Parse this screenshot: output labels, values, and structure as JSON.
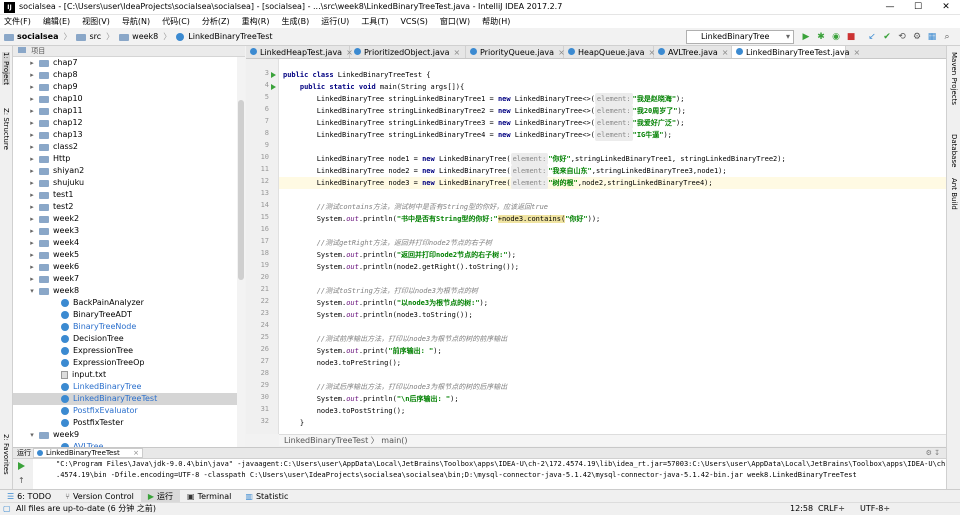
{
  "window": {
    "title": "socialsea - [C:\\Users\\user\\IdeaProjects\\socialsea\\socialsea] - [socialsea] - ...\\src\\week8\\LinkedBinaryTreeTest.java - IntelliJ IDEA 2017.2.7",
    "logo": "IJ",
    "minimize": "—",
    "maximize": "☐",
    "close": "✕"
  },
  "menu": [
    "文件(F)",
    "编辑(E)",
    "视图(V)",
    "导航(N)",
    "代码(C)",
    "分析(Z)",
    "重构(R)",
    "生成(B)",
    "运行(U)",
    "工具(T)",
    "VCS(S)",
    "窗口(W)",
    "帮助(H)"
  ],
  "breadcrumb": [
    "socialsea",
    "src",
    "week8",
    "LinkedBinaryTreeTest"
  ],
  "run_config": "LinkedBinaryTree",
  "left_strip": {
    "project": "1: Project",
    "structure": "Z: Structure",
    "favorites": "2: Favorites"
  },
  "right_strip": {
    "maven": "Maven Projects",
    "database": "Database",
    "ant": "Ant Build"
  },
  "project_panel": {
    "header": "项目",
    "items": [
      {
        "label": "chap7",
        "kind": "folder",
        "depth": 1,
        "expanded": false
      },
      {
        "label": "chap8",
        "kind": "folder",
        "depth": 1,
        "expanded": false
      },
      {
        "label": "chap9",
        "kind": "folder",
        "depth": 1,
        "expanded": false
      },
      {
        "label": "chap10",
        "kind": "folder",
        "depth": 1,
        "expanded": false
      },
      {
        "label": "chap11",
        "kind": "folder",
        "depth": 1,
        "expanded": false
      },
      {
        "label": "chap12",
        "kind": "folder",
        "depth": 1,
        "expanded": false
      },
      {
        "label": "chap13",
        "kind": "folder",
        "depth": 1,
        "expanded": false
      },
      {
        "label": "class2",
        "kind": "folder",
        "depth": 1,
        "expanded": false
      },
      {
        "label": "Http",
        "kind": "folder",
        "depth": 1,
        "expanded": false
      },
      {
        "label": "shiyan2",
        "kind": "folder",
        "depth": 1,
        "expanded": false
      },
      {
        "label": "shujuku",
        "kind": "folder",
        "depth": 1,
        "expanded": false
      },
      {
        "label": "test1",
        "kind": "folder",
        "depth": 1,
        "expanded": false
      },
      {
        "label": "test2",
        "kind": "folder",
        "depth": 1,
        "expanded": false
      },
      {
        "label": "week2",
        "kind": "folder",
        "depth": 1,
        "expanded": false
      },
      {
        "label": "week3",
        "kind": "folder",
        "depth": 1,
        "expanded": false
      },
      {
        "label": "week4",
        "kind": "folder",
        "depth": 1,
        "expanded": false
      },
      {
        "label": "week5",
        "kind": "folder",
        "depth": 1,
        "expanded": false
      },
      {
        "label": "week6",
        "kind": "folder",
        "depth": 1,
        "expanded": false
      },
      {
        "label": "week7",
        "kind": "folder",
        "depth": 1,
        "expanded": false
      },
      {
        "label": "week8",
        "kind": "folder",
        "depth": 1,
        "expanded": true
      },
      {
        "label": "BackPainAnalyzer",
        "kind": "class",
        "depth": 2
      },
      {
        "label": "BinaryTreeADT",
        "kind": "class",
        "depth": 2
      },
      {
        "label": "BinaryTreeNode",
        "kind": "class-blue",
        "depth": 2
      },
      {
        "label": "DecisionTree",
        "kind": "class",
        "depth": 2
      },
      {
        "label": "ExpressionTree",
        "kind": "class",
        "depth": 2
      },
      {
        "label": "ExpressionTreeOp",
        "kind": "class",
        "depth": 2
      },
      {
        "label": "input.txt",
        "kind": "text",
        "depth": 2
      },
      {
        "label": "LinkedBinaryTree",
        "kind": "class-blue",
        "depth": 2
      },
      {
        "label": "LinkedBinaryTreeTest",
        "kind": "class-selected",
        "depth": 2
      },
      {
        "label": "PostfixEvaluator",
        "kind": "class-blue",
        "depth": 2
      },
      {
        "label": "PostfixTester",
        "kind": "class",
        "depth": 2
      },
      {
        "label": "week9",
        "kind": "folder",
        "depth": 1,
        "expanded": true
      },
      {
        "label": "AVLTree",
        "kind": "class-blue",
        "depth": 2
      }
    ]
  },
  "tabs": [
    {
      "label": "LinkedHeapTest.java",
      "close": "×"
    },
    {
      "label": "PrioritizedObject.java",
      "close": "×"
    },
    {
      "label": "PriorityQueue.java",
      "close": "×"
    },
    {
      "label": "HeapQueue.java",
      "close": "×"
    },
    {
      "label": "AVLTree.java",
      "close": "×"
    },
    {
      "label": "LinkedBinaryTreeTest.java",
      "close": "×",
      "active": true
    }
  ],
  "editor": {
    "line_numbers": [
      "3",
      "4",
      "5",
      "6",
      "7",
      "8",
      "9",
      "10",
      "11",
      "12",
      "13",
      "14",
      "15",
      "16",
      "17",
      "18",
      "19",
      "20",
      "21",
      "22",
      "23",
      "24",
      "25",
      "26",
      "27",
      "28",
      "29",
      "30",
      "31",
      "32"
    ],
    "breadcrumb": "LinkedBinaryTreeTest  〉 main()",
    "code": {
      "l3a": "public class",
      "l3b": " LinkedBinaryTreeTest {",
      "l4a": "    public static void",
      "l4b": " main(String args[]){",
      "l5a": "        LinkedBinaryTree stringLinkedBinaryTree1 = ",
      "l5b": "new",
      "l5c": " LinkedBinaryTree<>(",
      "l5h": "element:",
      "l5s": "\"我是赵晓海\"",
      "l5e": ");",
      "l6a": "        LinkedBinaryTree stringLinkedBinaryTree2 = ",
      "l6b": "new",
      "l6c": " LinkedBinaryTree<>(",
      "l6h": "element:",
      "l6s": "\"我20周岁了\"",
      "l6e": ");",
      "l7a": "        LinkedBinaryTree stringLinkedBinaryTree3 = ",
      "l7b": "new",
      "l7c": " LinkedBinaryTree<>(",
      "l7h": "element:",
      "l7s": "\"我爱好广泛\"",
      "l7e": ");",
      "l8a": "        LinkedBinaryTree stringLinkedBinaryTree4 = ",
      "l8b": "new",
      "l8c": " LinkedBinaryTree<>(",
      "l8h": "element:",
      "l8s": "\"IG牛逼\"",
      "l8e": ");",
      "l10a": "        LinkedBinaryTree node1 = ",
      "l10b": "new",
      "l10c": " LinkedBinaryTree(",
      "l10h": "element:",
      "l10s": "\"你好\"",
      "l10e": ",stringLinkedBinaryTree1, stringLinkedBinaryTree2);",
      "l11a": "        LinkedBinaryTree node2 = ",
      "l11b": "new",
      "l11c": " LinkedBinaryTree(",
      "l11h": "element:",
      "l11s": "\"我来自山东\"",
      "l11e": ",stringLinkedBinaryTree3,node1);",
      "l12a": "        LinkedBinaryTree node3 = ",
      "l12b": "new",
      "l12c": " LinkedBinaryTree(",
      "l12h": "element:",
      "l12s": "\"树的根\"",
      "l12e": ",node2,stringLinkedBinaryTree4);",
      "l14": "        //测试contains方法，测试树中是否有String型的你好，应该返回true",
      "l15a": "        System.",
      "l15f": "out",
      "l15b": ".println(",
      "l15s": "\"书中是否有String型的你好:\"",
      "l15c": "+node3.contains(",
      "l15s2": "\"你好\"",
      "l15e": "));",
      "l17": "        //测试getRight方法，返回并打印node2节点的右子树",
      "l18a": "        System.",
      "l18f": "out",
      "l18b": ".println(",
      "l18s": "\"返回并打印node2节点的右子树:\"",
      "l18e": ");",
      "l19a": "        System.",
      "l19f": "out",
      "l19b": ".println(node2.getRight().toString());",
      "l21": "        //测试toString方法，打印以node3为根节点的树",
      "l22a": "        System.",
      "l22f": "out",
      "l22b": ".println(",
      "l22s": "\"以node3为根节点的树:\"",
      "l22e": ");",
      "l23a": "        System.",
      "l23f": "out",
      "l23b": ".println(node3.toString());",
      "l25": "        //测试前序输出方法，打印以node3为根节点的树的前序输出",
      "l26a": "        System.",
      "l26f": "out",
      "l26b": ".print(",
      "l26s": "\"前序输出: \"",
      "l26e": ");",
      "l27": "        node3.toPreString();",
      "l29": "        //测试后序输出方法，打印以node3为根节点的树的后序输出",
      "l30a": "        System.",
      "l30f": "out",
      "l30b": ".println(",
      "l30s": "\"\\n后序输出: \"",
      "l30e": ");",
      "l31": "        node3.toPostString();",
      "l32": "    }",
      "l33": "}"
    }
  },
  "run_panel": {
    "label": "运行",
    "tab": "LinkedBinaryTreeTest",
    "console_line1": "\"C:\\Program Files\\Java\\jdk-9.0.4\\bin\\java\" -javaagent:C:\\Users\\user\\AppData\\Local\\JetBrains\\Toolbox\\apps\\IDEA-U\\ch-2\\172.4574.19\\lib\\idea_rt.jar=57003:C:\\Users\\user\\AppData\\Local\\JetBrains\\Toolbox\\apps\\IDEA-U\\ch-2\\172",
    "console_line2": ".4574.19\\bin -Dfile.encoding=UTF-8 -classpath C:\\Users\\user\\IdeaProjects\\socialsea\\socialsea\\bin;D:\\mysql-connector-java-5.1.42\\mysql-connector-java-5.1.42-bin.jar week8.LinkedBinaryTreeTest"
  },
  "bottom_tabs": [
    {
      "label": "6: TODO"
    },
    {
      "label": "Version Control"
    },
    {
      "label": "运行",
      "active": true
    },
    {
      "label": "Terminal"
    },
    {
      "label": "Statistic"
    }
  ],
  "status": {
    "message": "All files are up-to-date (6 分钟 之前)",
    "position": "12:58",
    "line_sep": "CRLF÷",
    "encoding": "UTF-8÷"
  }
}
